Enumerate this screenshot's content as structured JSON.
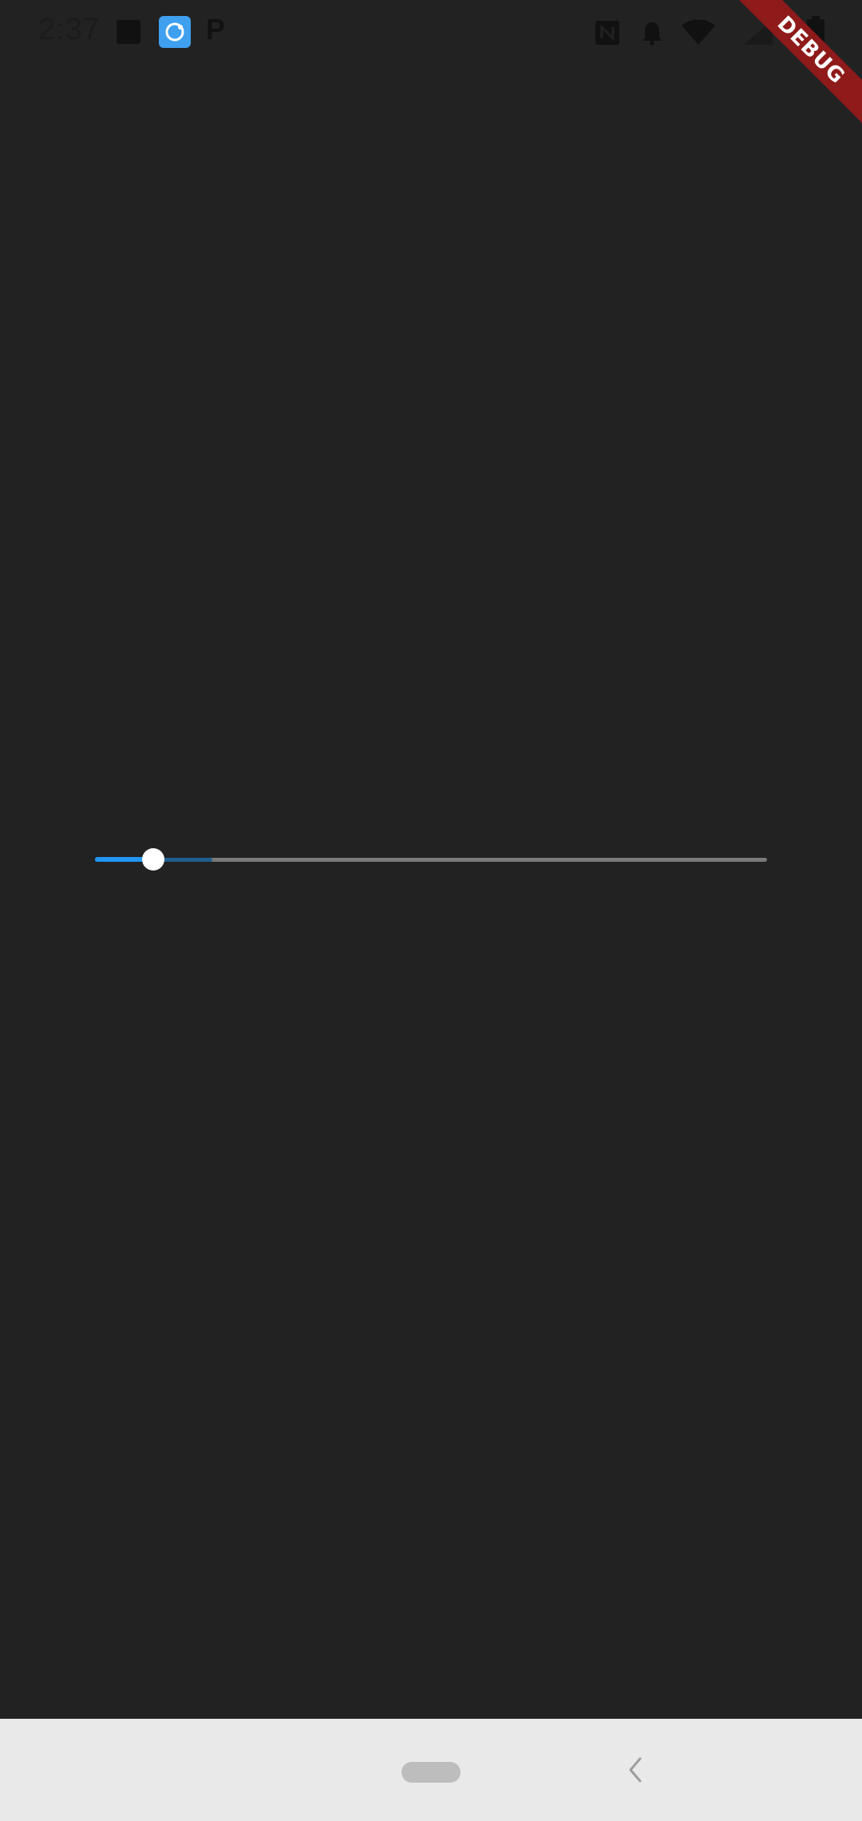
{
  "status_bar": {
    "time": "2:37",
    "icons": [
      "square-icon",
      "screen-recorder-icon",
      "p-icon",
      "nfc-icon",
      "notification-bell-icon",
      "wifi-icon",
      "signal-icon",
      "battery-icon"
    ],
    "p_glyph": "P"
  },
  "debug_banner": {
    "label": "DEBUG",
    "color": "#8e1a1a"
  },
  "slider": {
    "value_fraction": 0.087,
    "buffered_fraction": 0.175,
    "active_color": "#2196f3",
    "inactive_color": "#7a7a7a"
  },
  "nav_bar": {
    "icons": [
      "home-pill-icon",
      "back-icon"
    ]
  }
}
